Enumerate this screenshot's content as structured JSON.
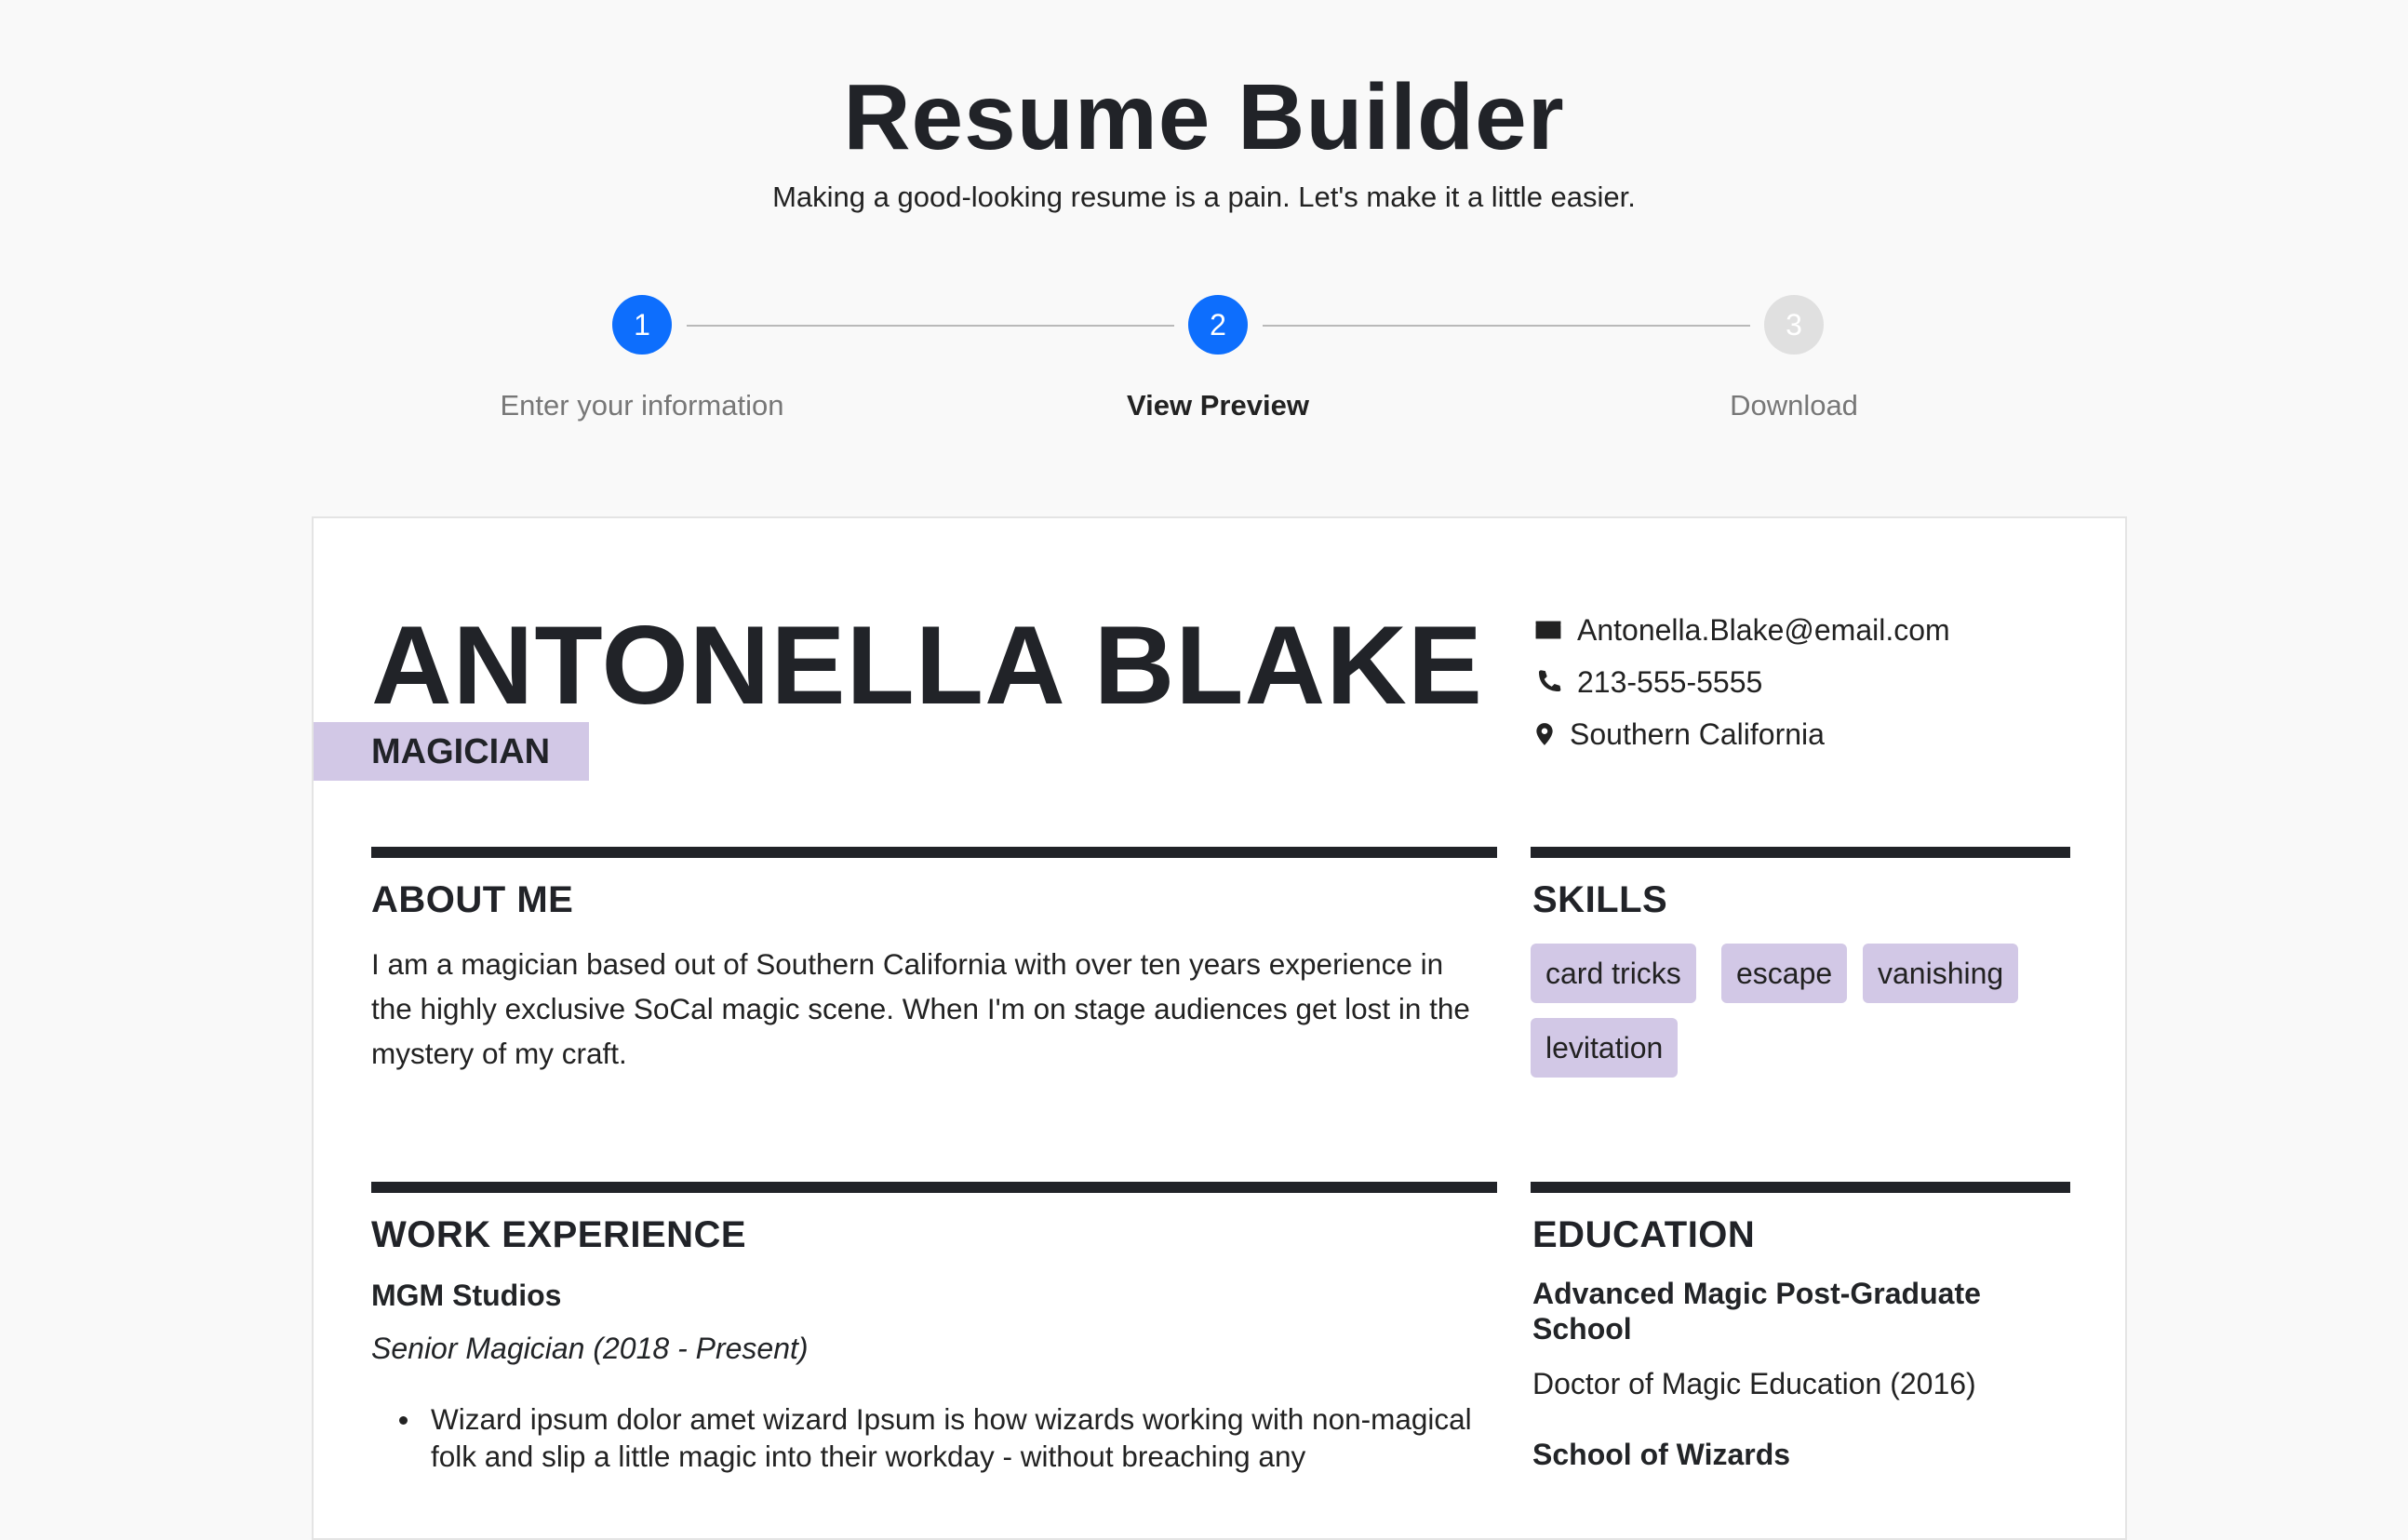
{
  "header": {
    "title": "Resume Builder",
    "subtitle": "Making a good-looking resume is a pain. Let's make it a little easier."
  },
  "stepper": {
    "steps": [
      {
        "number": "1",
        "label": "Enter your information",
        "state": "complete"
      },
      {
        "number": "2",
        "label": "View Preview",
        "state": "current"
      },
      {
        "number": "3",
        "label": "Download",
        "state": "upcoming"
      }
    ],
    "active_color": "#0d6efd",
    "inactive_color": "#e0e0e0"
  },
  "resume": {
    "name": "ANTONELLA BLAKE",
    "job_title": "MAGICIAN",
    "accent_color": "#d2c8e6",
    "contact": {
      "email": "Antonella.Blake@email.com",
      "phone": "213-555-5555",
      "location": "Southern California"
    },
    "about": {
      "heading": "ABOUT ME",
      "text": "I am a magician based out of Southern California with over ten years experience in the highly exclusive SoCal magic scene. When I'm on stage audiences get lost in the mystery of my craft."
    },
    "skills": {
      "heading": "SKILLS",
      "items": [
        "card tricks",
        "escape",
        "vanishing",
        "levitation"
      ]
    },
    "work": {
      "heading": "WORK EXPERIENCE",
      "company": "MGM Studios",
      "role": "Senior Magician (2018 - Present)",
      "bullets": [
        "Wizard ipsum dolor amet wizard Ipsum is how wizards working with non-magical folk and slip a little magic into their workday - without breaching any"
      ]
    },
    "education": {
      "heading": "EDUCATION",
      "entries": [
        {
          "school": "Advanced Magic Post-Graduate School",
          "degree": "Doctor of Magic Education (2016)"
        },
        {
          "school": "School of Wizards",
          "degree": ""
        }
      ]
    }
  }
}
